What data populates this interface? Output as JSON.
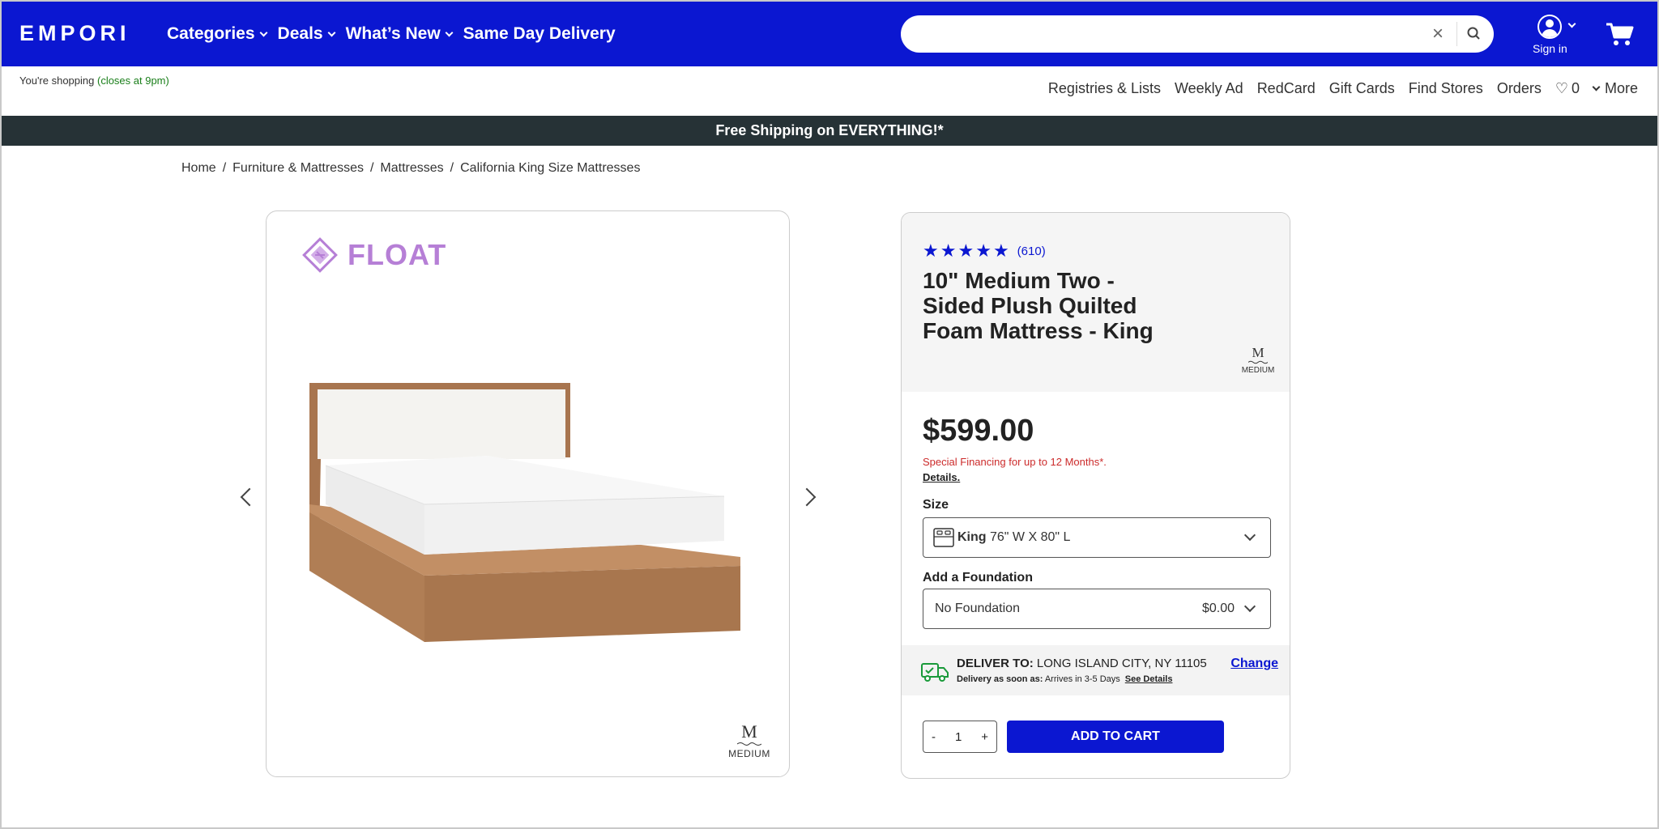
{
  "brand": {
    "logo": "EMPORI"
  },
  "nav": {
    "items": [
      {
        "label": "Categories",
        "chevron": true
      },
      {
        "label": "Deals",
        "chevron": true
      },
      {
        "label": "What’s New",
        "chevron": true
      },
      {
        "label": "Same Day Delivery",
        "chevron": false
      }
    ]
  },
  "search": {
    "placeholder": "",
    "value": "",
    "clear_icon": "close-icon",
    "search_icon": "search-icon"
  },
  "account": {
    "label": "Sign in"
  },
  "store": {
    "prefix": "You're shopping",
    "status": "(closes at 9pm)"
  },
  "utility_links": {
    "registries": "Registries & Lists",
    "weekly_ad": "Weekly Ad",
    "redcard": "RedCard",
    "gift_cards": "Gift Cards",
    "find_stores": "Find Stores",
    "orders": "Orders",
    "favorites_count": "0",
    "more": "More"
  },
  "promo": {
    "text": "Free Shipping on EVERYTHING!*"
  },
  "breadcrumb": {
    "items": [
      "Home",
      "Furniture & Mattresses",
      "Mattresses",
      "California King Size Mattresses"
    ],
    "separator": "/"
  },
  "product_image": {
    "brand_name": "FLOAT",
    "brand_color": "#b67fd6",
    "badge_letter": "M",
    "badge_label": "MEDIUM"
  },
  "product": {
    "rating": 5,
    "reviews": "(610)",
    "title": "10\" Medium Two - Sided Plush Quilted Foam Mattress - King",
    "badge_letter": "M",
    "badge_label": "MEDIUM",
    "price": "$599.00",
    "financing": "Special Financing for up to 12 Months*.",
    "details_link": "Details."
  },
  "size": {
    "label": "Size",
    "selected_name": "King",
    "selected_dims": " 76\" W X 80\" L"
  },
  "foundation": {
    "label": "Add a Foundation",
    "selected": "No Foundation",
    "price": "$0.00"
  },
  "delivery": {
    "label": "DELIVER TO:",
    "location": " LONG ISLAND CITY, NY 11105",
    "soon_label": "Delivery as soon as:",
    "soon_value": " Arrives in 3-5 Days",
    "see_details": "See Details",
    "change": "Change"
  },
  "cart": {
    "minus": "-",
    "quantity": "1",
    "plus": "+",
    "add_label": "ADD TO CART"
  },
  "colors": {
    "primary": "#0b17d1",
    "promo_bar": "#263236",
    "financing": "#cc2b2b",
    "open_status": "#1a7f1a"
  }
}
